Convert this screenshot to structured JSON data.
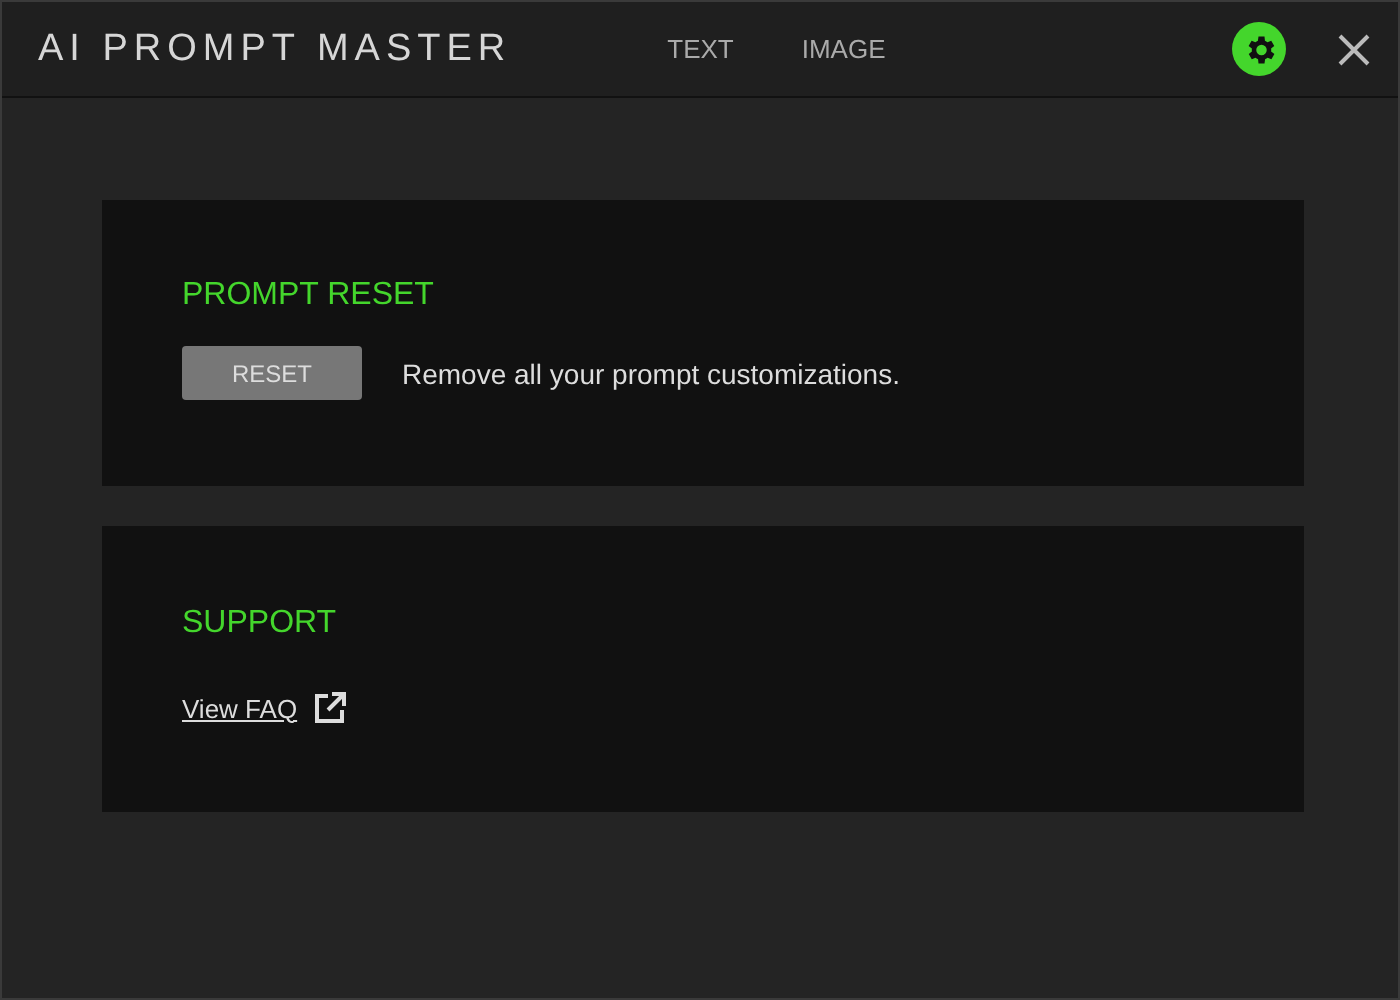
{
  "window": {
    "title": "AI PROMPT MASTER"
  },
  "tabs": [
    {
      "label": "TEXT",
      "selected": false
    },
    {
      "label": "IMAGE",
      "selected": false
    }
  ],
  "settings": {
    "selected": true
  },
  "sections": [
    {
      "heading": "PROMPT RESET",
      "kind": "action",
      "button": "RESET",
      "description": "Remove all your prompt customizations."
    },
    {
      "heading": "SUPPORT",
      "kind": "link",
      "link": "View FAQ"
    }
  ]
}
